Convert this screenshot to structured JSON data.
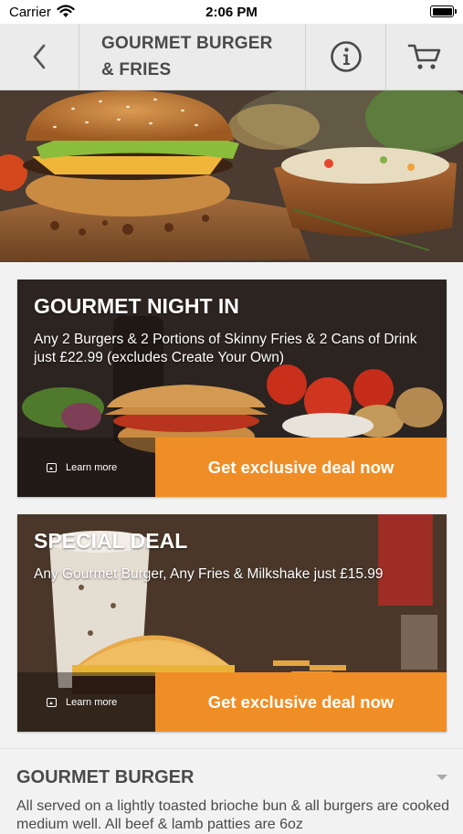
{
  "status": {
    "carrier": "Carrier",
    "time": "2:06 PM"
  },
  "nav": {
    "title_line1": "GOURMET BURGER",
    "title_line2": "& FRIES"
  },
  "deals": [
    {
      "title": "GOURMET NIGHT IN",
      "description": "Any 2 Burgers & 2 Portions of Skinny Fries & 2 Cans of Drink just £22.99 (excludes Create Your Own)",
      "learn_more": "Learn more",
      "cta": "Get exclusive deal now"
    },
    {
      "title": "SPECIAL DEAL",
      "description": "Any Gourmet Burger, Any Fries & Milkshake just £15.99",
      "learn_more": "Learn more",
      "cta": "Get exclusive deal now"
    }
  ],
  "section": {
    "title": "GOURMET BURGER",
    "description": "All served on a lightly toasted brioche bun & all burgers are cooked medium well. All beef & lamb patties are 6oz"
  },
  "colors": {
    "accent": "#ef8e26",
    "nav_bg": "#ebebeb",
    "page_bg": "#f2f2f2",
    "text": "#4a4a4a"
  },
  "icons": {
    "back": "chevron-left-icon",
    "info": "info-icon",
    "cart": "cart-icon",
    "wifi": "wifi-icon",
    "battery": "battery-icon"
  }
}
